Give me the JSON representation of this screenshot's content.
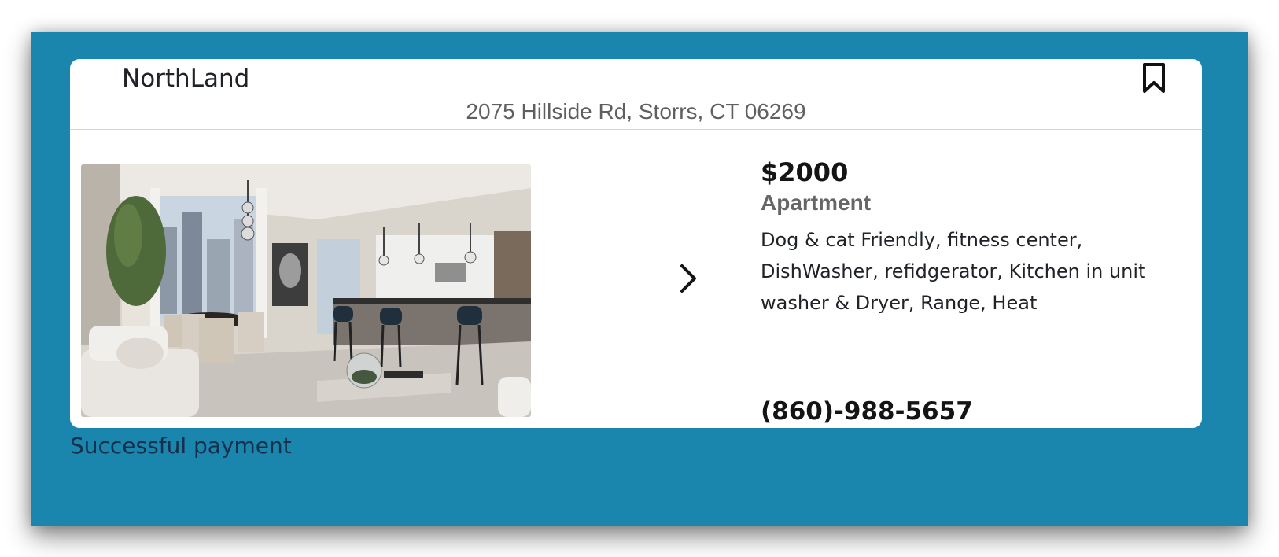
{
  "listing": {
    "name": "NorthLand",
    "address": "2075 Hillside Rd, Storrs, CT 06269",
    "price": "$2000",
    "property_type": "Apartment",
    "amenities": "Dog & cat Friendly, fitness center, DishWasher, refidgerator, Kitchen in unit washer & Dryer, Range, Heat",
    "phone": "(860)-988-5657",
    "photo_subject": "apartment interior with dining area and kitchen"
  },
  "status": {
    "message": "Successful payment"
  },
  "icons": {
    "bookmark": "bookmark-icon",
    "next": "chevron-right-icon"
  },
  "colors": {
    "background": "#1b86ad",
    "card": "#ffffff",
    "text_dark": "#1f2328",
    "text_muted": "#666666"
  }
}
